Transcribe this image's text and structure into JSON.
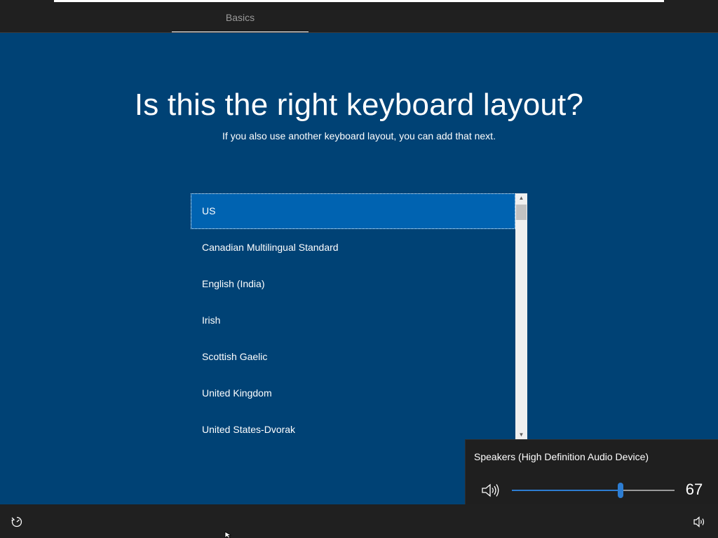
{
  "header": {
    "tab_label": "Basics"
  },
  "main": {
    "title": "Is this the right keyboard layout?",
    "subtitle": "If you also use another keyboard layout, you can add that next.",
    "layouts": [
      "US",
      "Canadian Multilingual Standard",
      "English (India)",
      "Irish",
      "Scottish Gaelic",
      "United Kingdom",
      "United States-Dvorak"
    ],
    "selected_layout": "US"
  },
  "volume_flyout": {
    "device_name": "Speakers (High Definition Audio Device)",
    "volume": 67,
    "volume_label": "67",
    "accent_color": "#2d7dd2"
  },
  "icons": {
    "speaker": "speaker-icon",
    "accessibility": "ease-of-access-icon",
    "tray_volume": "volume-tray-icon"
  },
  "colors": {
    "background": "#004275",
    "selected_item": "#0063b1",
    "chrome": "#202020"
  }
}
